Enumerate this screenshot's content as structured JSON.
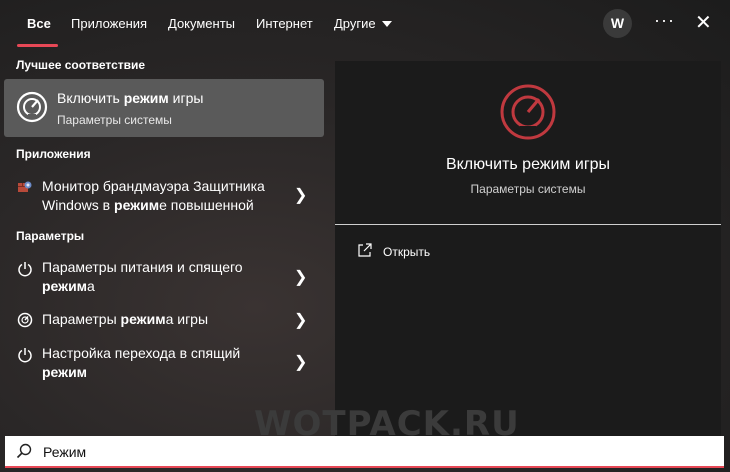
{
  "tabs": [
    "Все",
    "Приложения",
    "Документы",
    "Интернет",
    "Другие"
  ],
  "account_initial": "W",
  "more_label": "···",
  "close_label": "✕",
  "sections": {
    "best": "Лучшее соответствие",
    "apps": "Приложения",
    "settings": "Параметры"
  },
  "best_match": {
    "title_pre": "Включить ",
    "title_bold": "режим",
    "title_post": " игры",
    "subtitle": "Параметры системы"
  },
  "apps": [
    {
      "line1": "Монитор брандмауэра Защитника",
      "line2_pre": "Windows в ",
      "line2_bold": "режим",
      "line2_post": "е повышенной"
    }
  ],
  "settings": [
    {
      "line1": "Параметры питания и спящего",
      "line2_bold": "режим",
      "line2_post": "а"
    },
    {
      "pre": "Параметры ",
      "bold": "режим",
      "post": "а игры"
    },
    {
      "line1": "Настройка перехода в спящий",
      "line2_bold": "режим",
      "line2_post": ""
    }
  ],
  "detail": {
    "title": "Включить режим игры",
    "subtitle": "Параметры системы",
    "open_label": "Открыть"
  },
  "watermark": "WOTPACK.RU",
  "search": {
    "value": "Режим"
  },
  "colors": {
    "accent": "#e74856",
    "game_icon": "#c0393f"
  },
  "icons": [
    "gamebar-icon",
    "firewall-icon",
    "power-icon",
    "gamemode-icon",
    "chevron-right-icon",
    "open-icon",
    "search-icon"
  ]
}
